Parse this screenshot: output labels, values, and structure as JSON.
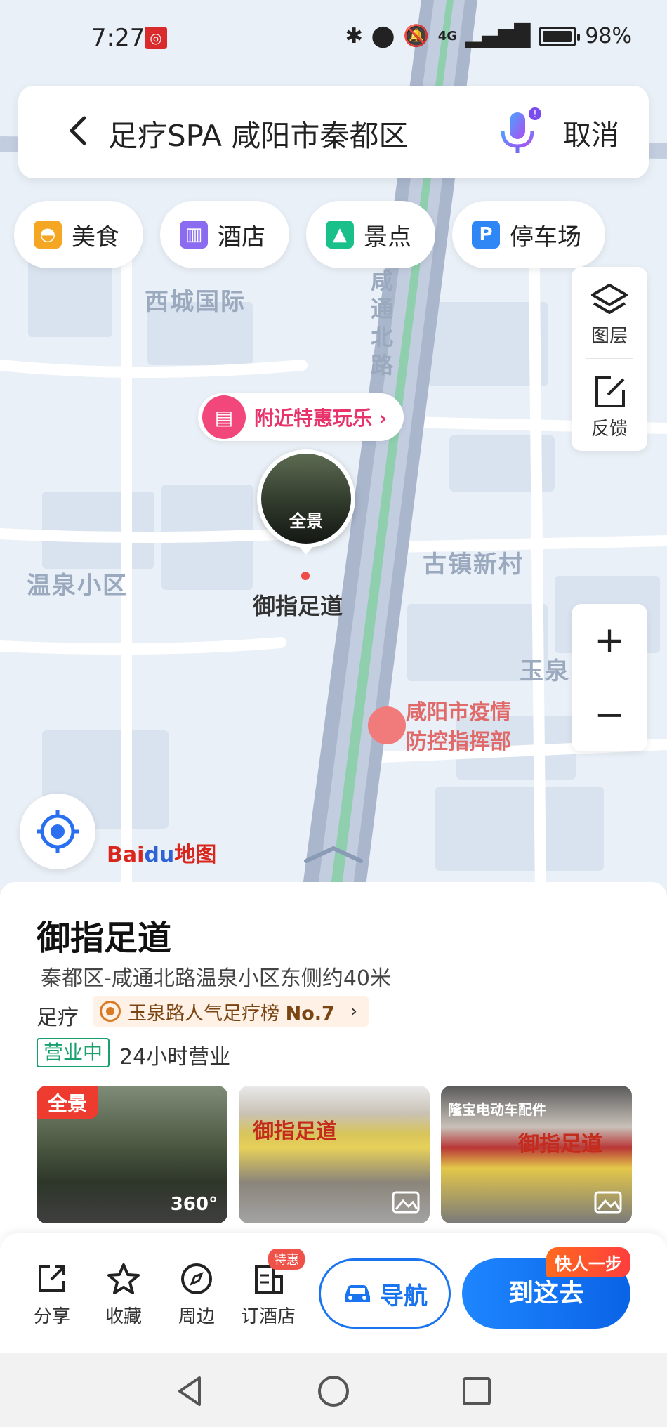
{
  "status_bar": {
    "time": "7:27",
    "app_badge": "8.0",
    "network": "4G",
    "battery": "98%",
    "battery_level": 0.98
  },
  "search": {
    "query": "足疗SPA 咸阳市秦都区",
    "cancel_label": "取消"
  },
  "categories": [
    {
      "label": "美食",
      "icon": "food-icon",
      "color": "#f5a623"
    },
    {
      "label": "酒店",
      "icon": "hotel-icon",
      "color": "#8b6cf0"
    },
    {
      "label": "景点",
      "icon": "scenic-icon",
      "color": "#19c08a"
    },
    {
      "label": "停车场",
      "icon": "parking-icon",
      "color": "#2f86f5"
    }
  ],
  "map_tools": {
    "layers_label": "图层",
    "feedback_label": "反馈",
    "zoom_in": "+",
    "zoom_out": "−"
  },
  "map": {
    "labels": {
      "xicheng": "西城国际",
      "road": "咸\n通\n北\n路",
      "wenquan": "温泉小区",
      "guzhen": "古镇新村",
      "yuquan": "玉泉"
    },
    "promo_label": "附近特惠玩乐 ›",
    "marker_photo_label": "全景",
    "marker_name": "御指足道",
    "red_poi_label": "咸阳市疫情\n防控指挥部",
    "logo_a": "Bai",
    "logo_b": "du",
    "logo_c": "地图"
  },
  "poi": {
    "name": "御指足道",
    "address": "秦都区-咸通北路温泉小区东侧约40米",
    "category": "足疗",
    "rank_text": "玉泉路人气足疗榜 ",
    "rank_no": "No.7",
    "open_status": "营业中",
    "hours": "24小时营业",
    "photos": [
      {
        "tag": "全景",
        "badge": "360°"
      },
      {
        "sign": "御指足道"
      },
      {
        "sign": "御指足道",
        "sign2": "隆宝电动车配件"
      }
    ]
  },
  "actions": {
    "share": "分享",
    "favorite": "收藏",
    "nearby": "周边",
    "book_hotel": "订酒店",
    "special_badge": "特惠",
    "navigate": "导航",
    "go_here": "到这去",
    "fast_badge": "快人一步"
  },
  "colors": {
    "primary": "#1a74f0",
    "open_green": "#1aa06d",
    "promo_pink": "#e8336b"
  }
}
